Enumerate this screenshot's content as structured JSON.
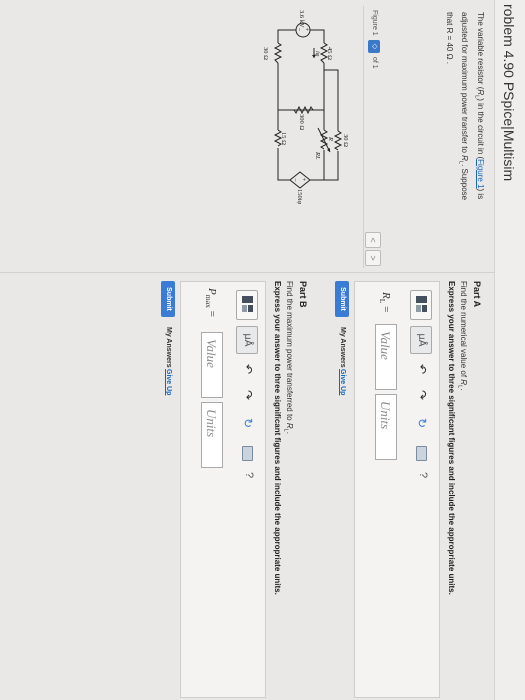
{
  "header": {
    "title": "roblem 4.90 PSpice|Multisim"
  },
  "problem": {
    "line1_a": "The variable resistor (",
    "line1_var": "R",
    "line1_sub": "L",
    "line1_b": ") in the circuit in (",
    "figure_link": "Figure 1",
    "line1_c": ") is",
    "line2_a": "adjusted for maximum power transfer to ",
    "line2_var": "R",
    "line2_sub": "L",
    "line2_b": ". Suppose",
    "line3": "that R = 40 Ω ."
  },
  "figure": {
    "label": "Figure 1",
    "select_glyph": "◇",
    "of_text": "of 1",
    "prev_glyph": "<",
    "next_glyph": ">"
  },
  "circuit": {
    "source_voltage": "3.6 kV",
    "source_plus": "+",
    "source_minus": "−",
    "r1": "45 Ω",
    "r2": "30 Ω",
    "r3": "300 Ω",
    "r4": "30 Ω",
    "r5": "15 Ω",
    "r_var": "R",
    "rl": "RL",
    "i_label": "iφ",
    "dep_source": "150iφ",
    "dep_plus": "+",
    "dep_minus": "−"
  },
  "partA": {
    "title": "Part A",
    "prompt_a": "Find the numerical value of ",
    "prompt_var": "R",
    "prompt_sub": "L",
    "prompt_b": ".",
    "instructions": "Express your answer to three significant figures and include the appropriate units.",
    "field_label_var": "R",
    "field_label_sub": "L",
    "field_label_eq": " =",
    "value_placeholder": "Value",
    "units_placeholder": "Units",
    "submit_label": "Submit",
    "my_answers": "My Answers",
    "give_up": "Give Up"
  },
  "partB": {
    "title": "Part B",
    "prompt_a": "Find the maximum power transferred to ",
    "prompt_var": "R",
    "prompt_sub": "L",
    "prompt_b": ".",
    "instructions": "Express your answer to three significant figures and include the appropriate units.",
    "field_label_var": "P",
    "field_label_sub": "max",
    "field_label_eq": " =",
    "value_placeholder": "Value",
    "units_placeholder": "Units",
    "submit_label": "Submit",
    "my_answers": "My Answers",
    "give_up": "Give Up"
  },
  "toolbar": {
    "units_glyph": "μÅ",
    "undo_glyph": "↶",
    "redo_glyph": "↷",
    "reset_glyph": "↻",
    "help_glyph": "?"
  }
}
